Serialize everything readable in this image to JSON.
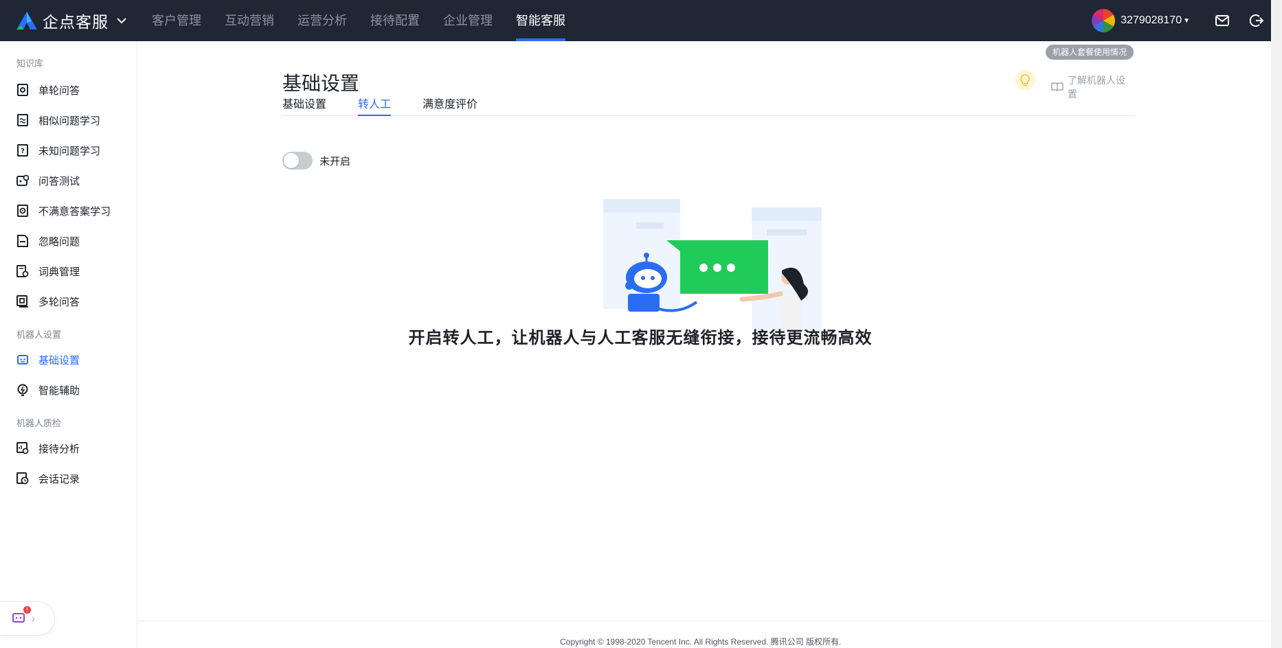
{
  "header": {
    "brand": "企点客服",
    "nav": [
      "客户管理",
      "互动营销",
      "运营分析",
      "接待配置",
      "企业管理",
      "智能客服"
    ],
    "active_nav": "智能客服",
    "account": "3279028170",
    "icons": [
      "mail-icon",
      "logout-icon"
    ]
  },
  "sidebar": {
    "groups": [
      {
        "title": "知识库",
        "items": [
          "单轮问答",
          "相似问题学习",
          "未知问题学习",
          "问答测试",
          "不满意答案学习",
          "忽略问题",
          "词典管理",
          "多轮问答"
        ]
      },
      {
        "title": "机器人设置",
        "items": [
          "基础设置",
          "智能辅助"
        ]
      },
      {
        "title": "机器人质检",
        "items": [
          "接待分析",
          "会话记录"
        ]
      }
    ],
    "active_item": "基础设置",
    "widget_badge": "!"
  },
  "main": {
    "usage_tag": "机器人套餐使用情况",
    "title": "基础设置",
    "learn_link": "了解机器人设置",
    "tabs": [
      "基础设置",
      "转人工",
      "满意度评价"
    ],
    "active_tab": "转人工",
    "toggle_label": "未开启",
    "toggle_on": false,
    "hero_text": "开启转人工，让机器人与人工客服无缝衔接，接待更流畅高效"
  },
  "footer": {
    "copyright": "Copyright © 1998-2020 Tencent Inc. All Rights Reserved. 腾讯公司 版权所有."
  },
  "colors": {
    "topbar": "#1f2634",
    "accent": "#2a6df4",
    "chat_bubble": "#1fcc5a"
  }
}
